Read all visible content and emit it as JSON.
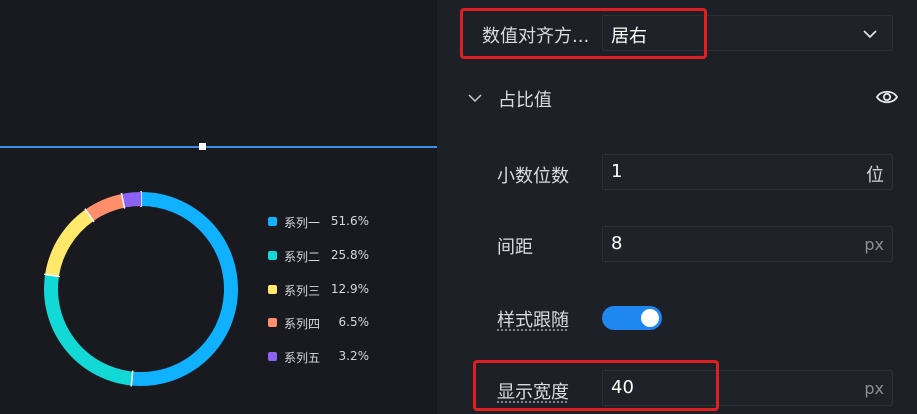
{
  "chart_data": {
    "type": "pie",
    "style": "donut",
    "series": [
      {
        "name": "系列一",
        "value_label": "51.6%",
        "value": 51.6,
        "color": "#10b1ff"
      },
      {
        "name": "系列二",
        "value_label": "25.8%",
        "value": 25.8,
        "color": "#12d9d6"
      },
      {
        "name": "系列三",
        "value_label": "12.9%",
        "value": 12.9,
        "color": "#ffe86a"
      },
      {
        "name": "系列四",
        "value_label": "6.5%",
        "value": 6.5,
        "color": "#ff8e6b"
      },
      {
        "name": "系列五",
        "value_label": "3.2%",
        "value": 3.2,
        "color": "#8a63f5"
      }
    ],
    "legend_position": "right"
  },
  "panel": {
    "align": {
      "label": "数值对齐方...",
      "value": "居右"
    },
    "section": {
      "title": "占比值"
    },
    "decimals": {
      "label": "小数位数",
      "value": "1",
      "unit": "位"
    },
    "spacing": {
      "label": "间距",
      "value": "8",
      "unit": "px"
    },
    "follow_style": {
      "label": "样式跟随",
      "checked": true
    },
    "display_width": {
      "label": "显示宽度",
      "value": "40",
      "unit": "px"
    }
  },
  "colors": {
    "accent": "#1e87f0",
    "highlight": "#e02020",
    "selection_line": "#3a8ee6"
  }
}
